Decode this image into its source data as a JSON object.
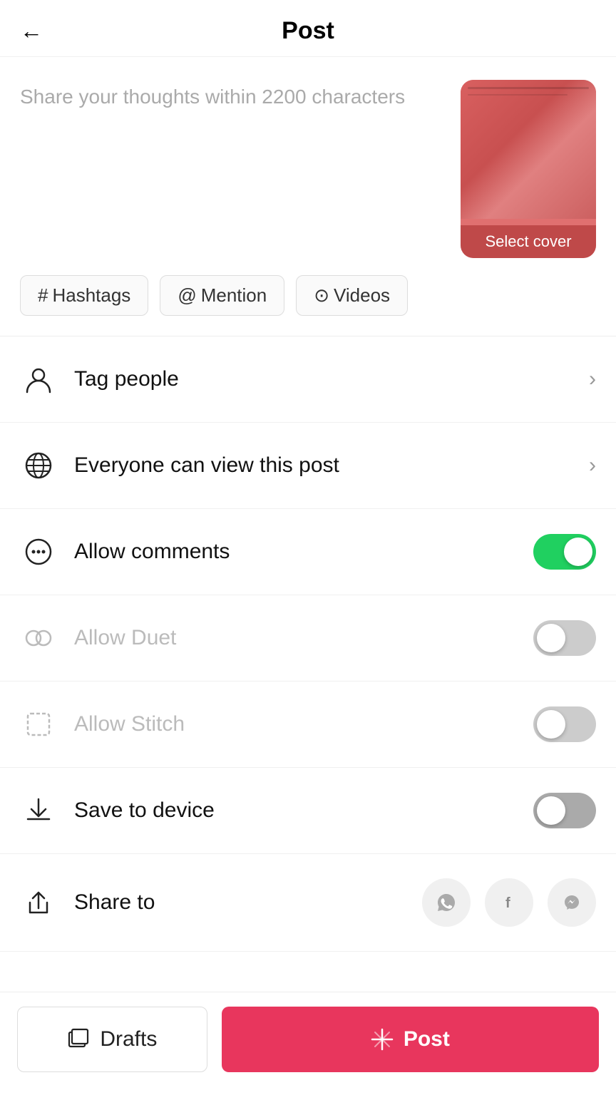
{
  "header": {
    "title": "Post",
    "back_label": "←"
  },
  "caption": {
    "placeholder": "Share your thoughts within 2200 characters"
  },
  "video": {
    "select_cover_label": "Select cover"
  },
  "tags": [
    {
      "id": "hashtags",
      "icon": "#",
      "label": "Hashtags"
    },
    {
      "id": "mention",
      "icon": "@",
      "label": "Mention"
    },
    {
      "id": "videos",
      "icon": "▶",
      "label": "Videos"
    }
  ],
  "menu": {
    "tag_people": "Tag people",
    "view_privacy": "Everyone can view this post",
    "allow_comments": "Allow comments",
    "allow_duet": "Allow Duet",
    "allow_stitch": "Allow Stitch",
    "save_to_device": "Save to device",
    "share_to": "Share to"
  },
  "toggles": {
    "allow_comments": "on",
    "allow_duet": "off",
    "allow_stitch": "off",
    "save_to_device": "off-dark"
  },
  "share_icons": [
    {
      "id": "whatsapp",
      "symbol": "💬"
    },
    {
      "id": "facebook",
      "symbol": "f"
    },
    {
      "id": "messenger",
      "symbol": "✈"
    }
  ],
  "footer": {
    "drafts_label": "Drafts",
    "post_label": "Post"
  }
}
